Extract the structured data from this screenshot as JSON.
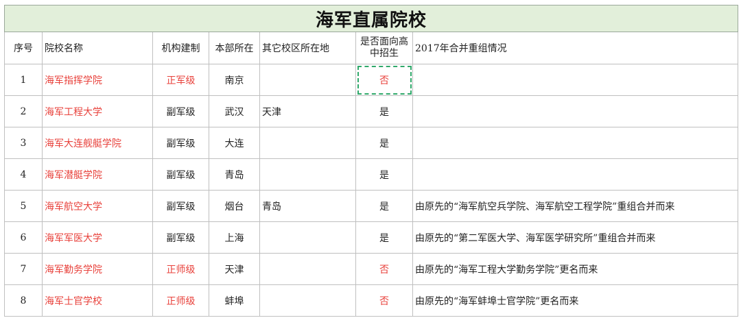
{
  "title": "海军直属院校",
  "headers": {
    "idx": "序号",
    "name": "院校名称",
    "level": "机构建制",
    "hq": "本部所在",
    "other": "其它校区所在地",
    "hs": "是否面向高中招生",
    "note": "2017年合并重组情况"
  },
  "rows": [
    {
      "idx": "1",
      "name": "海军指挥学院",
      "level": "正军级",
      "hq": "南京",
      "other": "",
      "hs": "否",
      "note": ""
    },
    {
      "idx": "2",
      "name": "海军工程大学",
      "level": "副军级",
      "hq": "武汉",
      "other": "天津",
      "hs": "是",
      "note": ""
    },
    {
      "idx": "3",
      "name": "海军大连舰艇学院",
      "level": "副军级",
      "hq": "大连",
      "other": "",
      "hs": "是",
      "note": ""
    },
    {
      "idx": "4",
      "name": "海军潜艇学院",
      "level": "副军级",
      "hq": "青岛",
      "other": "",
      "hs": "是",
      "note": ""
    },
    {
      "idx": "5",
      "name": "海军航空大学",
      "level": "副军级",
      "hq": "烟台",
      "other": "青岛",
      "hs": "是",
      "note": "由原先的“海军航空兵学院、海军航空工程学院”重组合并而来"
    },
    {
      "idx": "6",
      "name": "海军军医大学",
      "level": "副军级",
      "hq": "上海",
      "other": "",
      "hs": "是",
      "note": "由原先的“第二军医大学、海军医学研究所”重组合并而来"
    },
    {
      "idx": "7",
      "name": "海军勤务学院",
      "level": "正师级",
      "hq": "天津",
      "other": "",
      "hs": "否",
      "note": "由原先的“海军工程大学勤务学院”更名而来"
    },
    {
      "idx": "8",
      "name": "海军士官学校",
      "level": "正师级",
      "hq": "蚌埠",
      "other": "",
      "hs": "否",
      "note": "由原先的“海军蚌埠士官学院”更名而来"
    }
  ],
  "colors": {
    "title_bg": "#e2efda",
    "red_text": "#e8413b",
    "selection": "#2fa86a",
    "grid": "#bfbfbf"
  }
}
